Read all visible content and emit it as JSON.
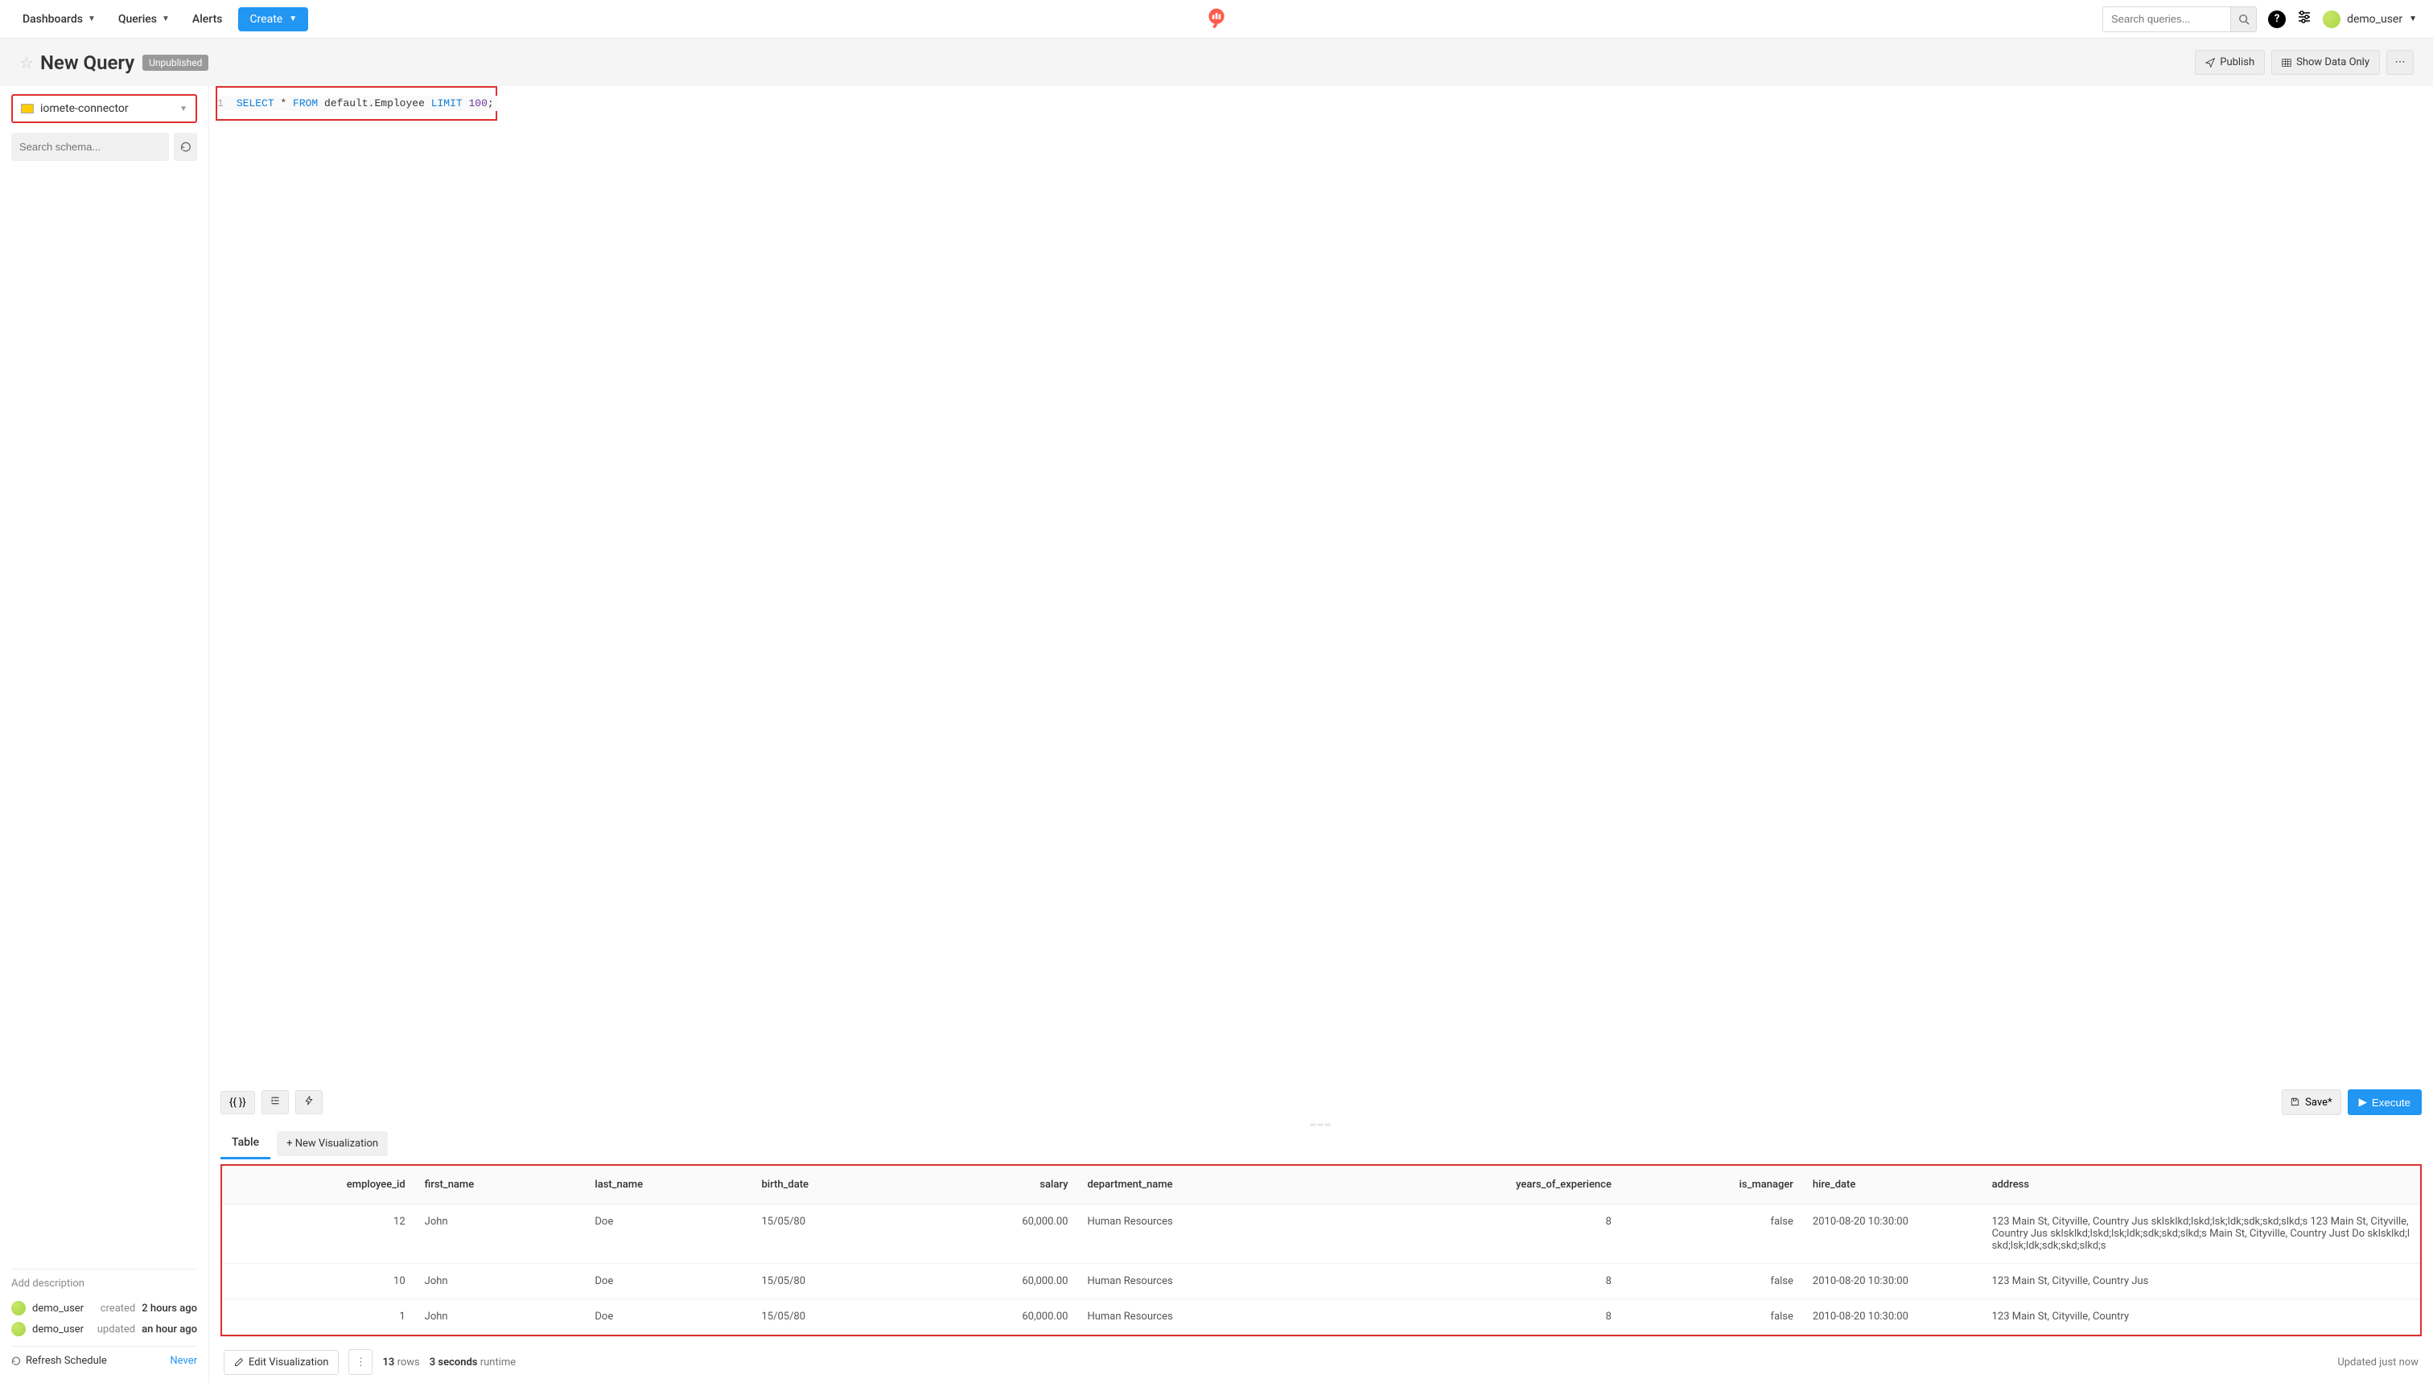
{
  "nav": {
    "dashboards": "Dashboards",
    "queries": "Queries",
    "alerts": "Alerts",
    "create": "Create",
    "search_placeholder": "Search queries...",
    "user": "demo_user"
  },
  "header": {
    "title": "New Query",
    "badge": "Unpublished",
    "publish": "Publish",
    "show_data_only": "Show Data Only"
  },
  "sidebar": {
    "datasource": "iomete-connector",
    "schema_placeholder": "Search schema...",
    "add_description": "Add description",
    "created_user": "demo_user",
    "created_label": "created",
    "created_time": "2 hours ago",
    "updated_user": "demo_user",
    "updated_label": "updated",
    "updated_time": "an hour ago",
    "refresh_schedule": "Refresh Schedule",
    "never": "Never"
  },
  "editor": {
    "line_no": "1",
    "kw_select": "SELECT",
    "star": " * ",
    "kw_from": "FROM",
    "ident_default": " default",
    "ident_employee": ".Employee ",
    "kw_limit": "LIMIT",
    "num_100": " 100",
    "semi": ";"
  },
  "toolbar": {
    "braces": "{{ }}",
    "save": "Save*",
    "execute": "Execute"
  },
  "tabs": {
    "table": "Table",
    "new_viz": "+ New Visualization"
  },
  "results": {
    "columns": [
      "employee_id",
      "first_name",
      "last_name",
      "birth_date",
      "salary",
      "department_name",
      "years_of_experience",
      "is_manager",
      "hire_date",
      "address"
    ],
    "rows": [
      {
        "employee_id": "12",
        "first_name": "John",
        "last_name": "Doe",
        "birth_date": "15/05/80",
        "salary": "60,000.00",
        "department_name": "Human Resources",
        "years_of_experience": "8",
        "is_manager": "false",
        "hire_date": "2010-08-20 10:30:00",
        "address": "123 Main St, Cityville, Country Jus sklsklkd;lskd;lsk;ldk;sdk;skd;slkd;s 123 Main St, Cityville, Country Jus sklsklkd;lskd;lsk;ldk;sdk;skd;slkd;s Main St, Cityville, Country Just Do sklsklkd;lskd;lsk;ldk;sdk;skd;slkd;s"
      },
      {
        "employee_id": "10",
        "first_name": "John",
        "last_name": "Doe",
        "birth_date": "15/05/80",
        "salary": "60,000.00",
        "department_name": "Human Resources",
        "years_of_experience": "8",
        "is_manager": "false",
        "hire_date": "2010-08-20 10:30:00",
        "address": "123 Main St, Cityville, Country Jus"
      },
      {
        "employee_id": "1",
        "first_name": "John",
        "last_name": "Doe",
        "birth_date": "15/05/80",
        "salary": "60,000.00",
        "department_name": "Human Resources",
        "years_of_experience": "8",
        "is_manager": "false",
        "hire_date": "2010-08-20 10:30:00",
        "address": "123 Main St, Cityville, Country"
      }
    ]
  },
  "footer": {
    "edit_viz": "Edit Visualization",
    "row_count": "13",
    "rows_label": "rows",
    "runtime_val": "3 seconds",
    "runtime_label": "runtime",
    "updated": "Updated just now"
  }
}
